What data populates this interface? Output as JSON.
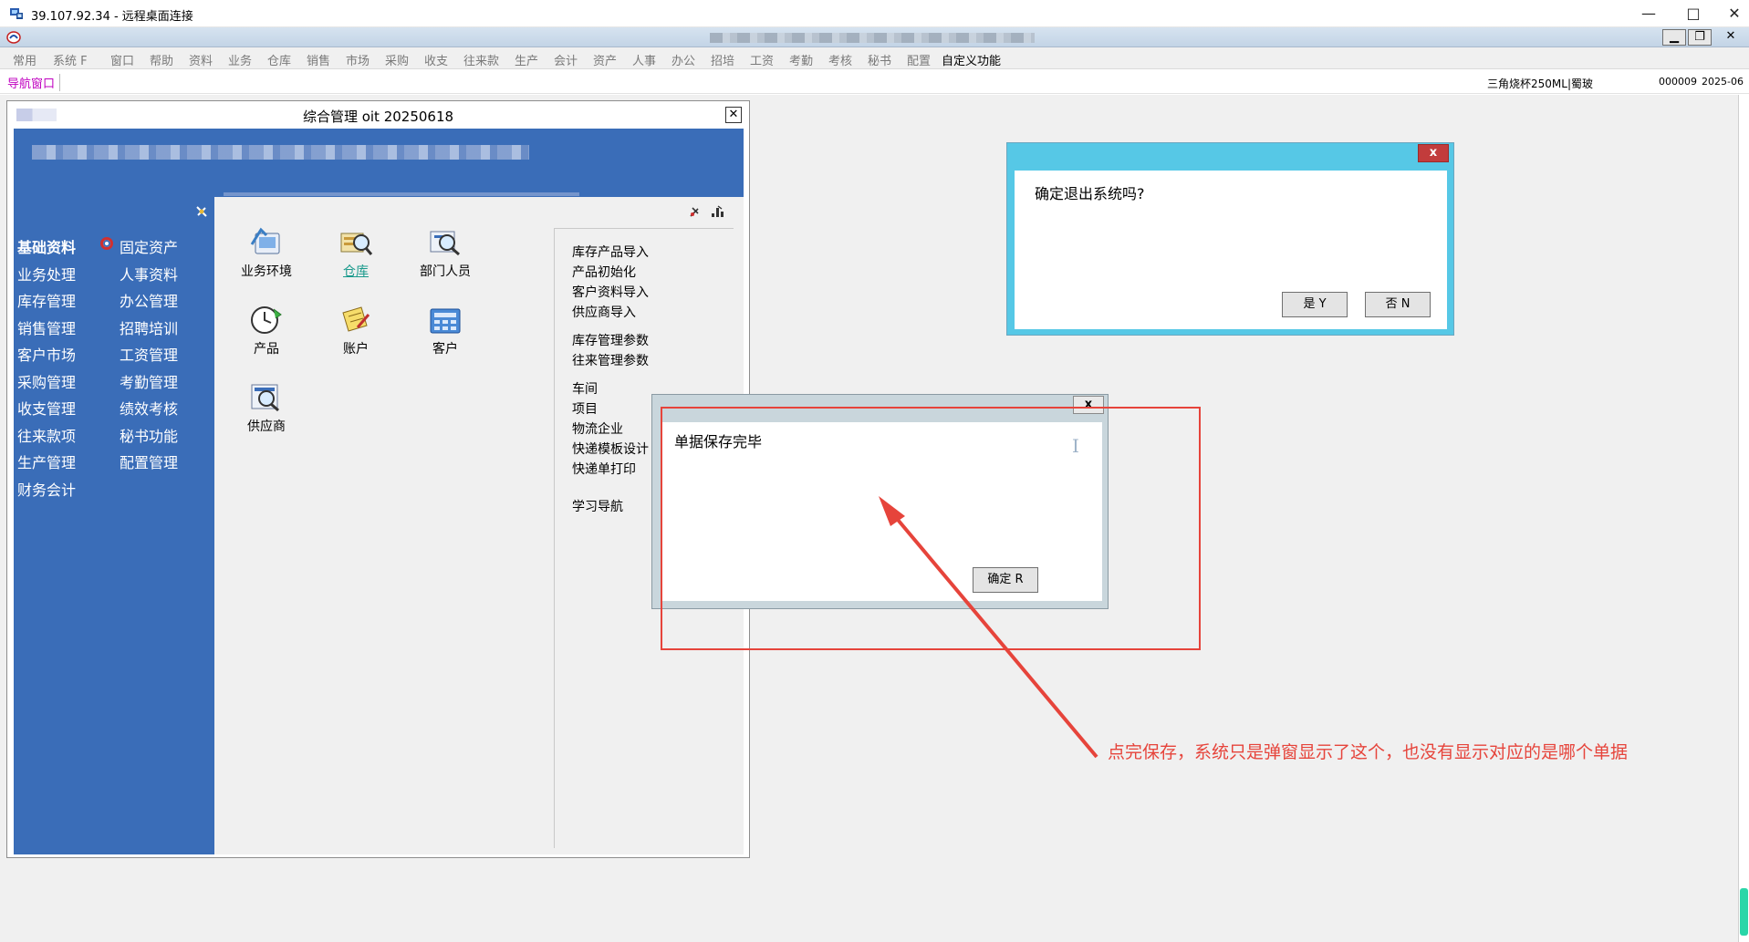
{
  "rdp_window": {
    "title": "39.107.92.34 - 远程桌面连接",
    "minimize_glyph": "—",
    "maximize_glyph": "□",
    "close_glyph": "✕"
  },
  "mdi_controls": {
    "minimize": "▁",
    "restore": "❐",
    "close": "✕"
  },
  "menu": [
    {
      "label": "常用",
      "active": false
    },
    {
      "label": "系统 F",
      "active": false
    },
    {
      "label": "窗口",
      "active": false
    },
    {
      "label": "帮助",
      "active": false
    },
    {
      "label": "资料",
      "active": false
    },
    {
      "label": "业务",
      "active": false
    },
    {
      "label": "仓库",
      "active": false
    },
    {
      "label": "销售",
      "active": false
    },
    {
      "label": "市场",
      "active": false
    },
    {
      "label": "采购",
      "active": false
    },
    {
      "label": "收支",
      "active": false
    },
    {
      "label": "往来款",
      "active": false
    },
    {
      "label": "生产",
      "active": false
    },
    {
      "label": "会计",
      "active": false
    },
    {
      "label": "资产",
      "active": false
    },
    {
      "label": "人事",
      "active": false
    },
    {
      "label": "办公",
      "active": false
    },
    {
      "label": "招培",
      "active": false
    },
    {
      "label": "工资",
      "active": false
    },
    {
      "label": "考勤",
      "active": false
    },
    {
      "label": "考核",
      "active": false
    },
    {
      "label": "秘书",
      "active": false
    },
    {
      "label": "配置",
      "active": false
    },
    {
      "label": "自定义功能",
      "active": true
    }
  ],
  "navbar": {
    "tab_label": "导航窗口",
    "product": "三角烧杯250ML|蜀玻",
    "code": "000009",
    "date": "2025-06"
  },
  "main_window": {
    "title": "综合管理 oit 20250618",
    "close_label": "✕"
  },
  "left_nav": {
    "col1": [
      "基础资料",
      "业务处理",
      "库存管理",
      "销售管理",
      "客户市场",
      "采购管理",
      "收支管理",
      "往来款项",
      "生产管理",
      "财务会计"
    ],
    "col2": [
      "固定资产",
      "人事资料",
      "办公管理",
      "招聘培训",
      "工资管理",
      "考勤管理",
      "绩效考核",
      "秘书功能",
      "配置管理"
    ]
  },
  "tiles": [
    {
      "label": "业务环境",
      "icon": "business-env-icon",
      "link": false
    },
    {
      "label": "仓库",
      "icon": "warehouse-icon",
      "link": true
    },
    {
      "label": "部门人员",
      "icon": "department-staff-icon",
      "link": false
    },
    {
      "label": "产品",
      "icon": "product-clock-icon",
      "link": false
    },
    {
      "label": "账户",
      "icon": "account-icon",
      "link": false
    },
    {
      "label": "客户",
      "icon": "customer-icon",
      "link": false
    },
    {
      "label": "供应商",
      "icon": "supplier-icon",
      "link": false
    }
  ],
  "quick_links": {
    "group1": [
      "库存产品导入",
      "产品初始化",
      "客户资料导入",
      "供应商导入"
    ],
    "group2": [
      "库存管理参数",
      "往来管理参数"
    ],
    "group3": [
      "车间",
      "项目",
      "物流企业",
      "快递模板设计",
      "快递单打印"
    ],
    "group4": [
      "学习导航"
    ]
  },
  "dialog_exit": {
    "close_label": "x",
    "message": "确定退出系统吗?",
    "yes_label": "是 Y",
    "no_label": "否 N"
  },
  "dialog_save": {
    "close_label": "x",
    "message": "单据保存完毕",
    "cursor_glyph": "I",
    "ok_label": "确定 R"
  },
  "annotation": {
    "text": "点完保存，系统只是弹窗显示了这个，也没有显示对应的是哪个单据",
    "color": "#e6443b"
  }
}
